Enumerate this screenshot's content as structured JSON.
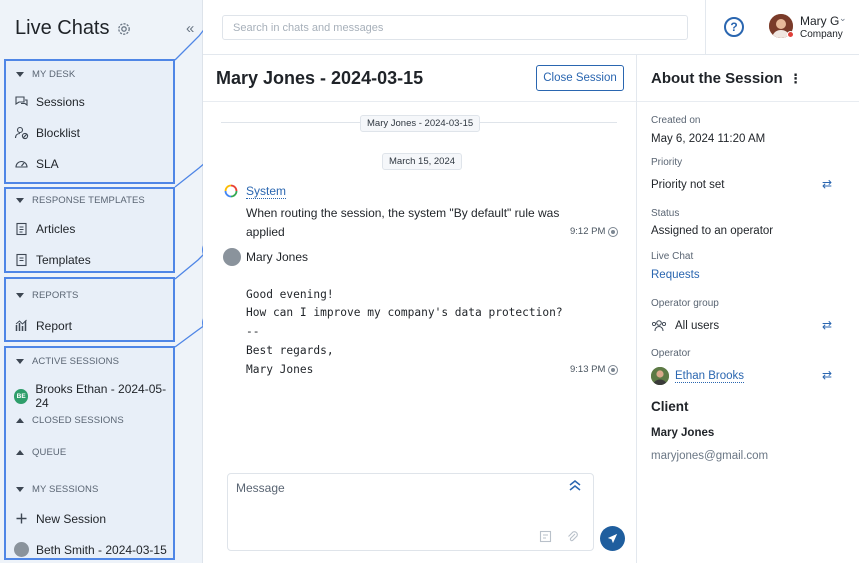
{
  "sidebar": {
    "title": "Live Chats",
    "sections": {
      "my_desk": "MY DESK",
      "response_templates": "RESPONSE TEMPLATES",
      "reports": "REPORTS",
      "active_sessions": "ACTIVE SESSIONS",
      "closed_sessions": "CLOSED SESSIONS",
      "queue": "QUEUE",
      "my_sessions": "MY SESSIONS"
    },
    "items": {
      "sessions": "Sessions",
      "blocklist": "Blocklist",
      "sla": "SLA",
      "articles": "Articles",
      "templates": "Templates",
      "report": "Report",
      "active_session": "Brooks Ethan - 2024-05-24",
      "active_session_initials": "BE",
      "new_session": "New Session",
      "my_session": "Beth Smith - 2024-03-15"
    },
    "markers": [
      "1",
      "2",
      "3",
      "4"
    ]
  },
  "topbar": {
    "search_placeholder": "Search in chats and messages",
    "help": "?",
    "user_name": "Mary G",
    "user_company": "Company"
  },
  "chat": {
    "title": "Mary Jones - 2024-03-15",
    "close_button": "Close Session",
    "session_pill": "Mary Jones - 2024-03-15",
    "date_pill": "March 15, 2024",
    "system_name": "System",
    "system_text_1": "When routing the session, the system \"By default\" rule was",
    "system_text_2": "applied",
    "system_time": "9:12 PM",
    "client_name": "Mary Jones",
    "message_lines": [
      "Good evening!",
      "How can I improve my company's data protection?",
      "--",
      "Best regards,",
      "Mary Jones"
    ],
    "client_time": "9:13 PM",
    "composer_placeholder": "Message"
  },
  "about": {
    "title": "About the Session",
    "created_label": "Created on",
    "created_value": "May 6, 2024 11:20 AM",
    "priority_label": "Priority",
    "priority_value": "Priority not set",
    "status_label": "Status",
    "status_value": "Assigned to an operator",
    "live_chat_label": "Live Chat",
    "live_chat_value": "Requests",
    "operator_group_label": "Operator group",
    "operator_group_value": "All users",
    "operator_label": "Operator",
    "operator_value": "Ethan Brooks",
    "client_heading": "Client",
    "client_name": "Mary Jones",
    "client_email": "maryjones@gmail.com"
  },
  "colors": {
    "accent": "#2a66b0",
    "marker": "#4f86e6",
    "sidebar_bg": "#eef3f9",
    "send": "#1f5e9e",
    "avatar_be": "#2e9e6b"
  }
}
